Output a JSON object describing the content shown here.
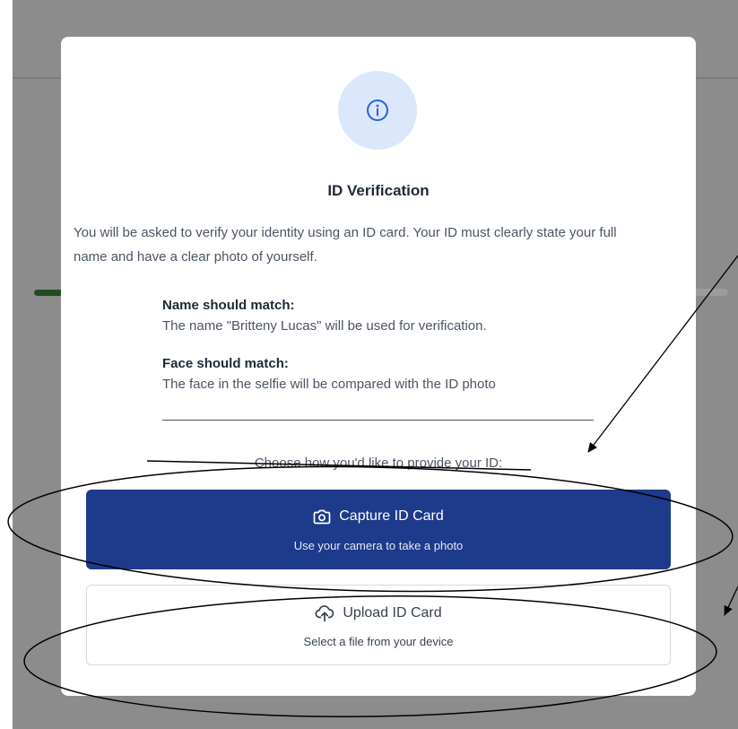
{
  "modal": {
    "title": "ID Verification",
    "intro": "You will be asked to verify your identity using an ID card. Your ID must clearly state your full name and have a clear photo of yourself.",
    "requirements": [
      {
        "heading": "Name should match:",
        "text": "The name \"Britteny Lucas\" will be used for verification."
      },
      {
        "heading": "Face should match:",
        "text": "The face in the selfie will be compared with the ID photo"
      }
    ],
    "choose_prompt": "Choose how you'd like to provide your ID:",
    "options": [
      {
        "label": "Capture ID Card",
        "sublabel": "Use your camera to take a photo",
        "icon": "camera-icon"
      },
      {
        "label": "Upload ID Card",
        "sublabel": "Select a file from your device",
        "icon": "cloud-upload-icon"
      }
    ],
    "header_icon": "info-icon"
  },
  "colors": {
    "primary": "#1e3a8a",
    "info_bg": "#dbe7fb",
    "info_icon": "#2563eb",
    "backdrop": "#8c8c8c",
    "progress": "#1e4d20"
  }
}
